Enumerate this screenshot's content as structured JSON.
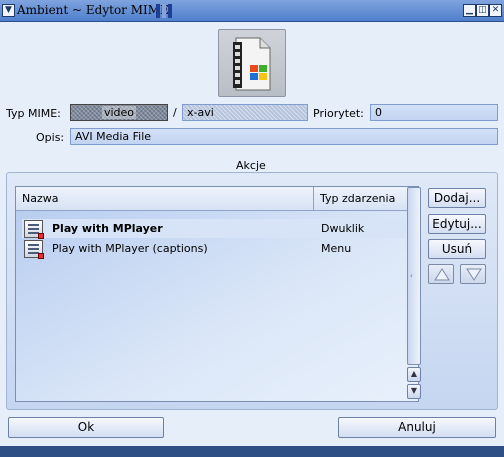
{
  "window": {
    "title": "Ambient ~ Edytor MIME",
    "menu_icon": "menu-triangle-icon",
    "buttons": [
      "iconify-icon",
      "zoom-icon",
      "close-icon"
    ]
  },
  "mime": {
    "label": "Typ MIME:",
    "category": "video",
    "separator": "/",
    "subtype": "x-avi",
    "priority_label": "Priorytet:",
    "priority_value": "0",
    "description_label": "Opis:",
    "description_value": "AVI Media File"
  },
  "actions": {
    "group_title": "Akcje",
    "columns": [
      "Nazwa",
      "Typ zdarzenia"
    ],
    "rows": [
      {
        "name": "Play with MPlayer",
        "type": "Dwuklik"
      },
      {
        "name": "Play with MPlayer (captions)",
        "type": "Menu"
      }
    ],
    "add_label": "Dodaj...",
    "edit_label": "Edytuj...",
    "remove_label": "Usuń"
  },
  "footer": {
    "ok_label": "Ok",
    "cancel_label": "Anuluj"
  },
  "colors": {
    "title_bar": "#5c88d2",
    "field_bg": "#c8d8f4",
    "list_bg": "#c7d8f3"
  }
}
